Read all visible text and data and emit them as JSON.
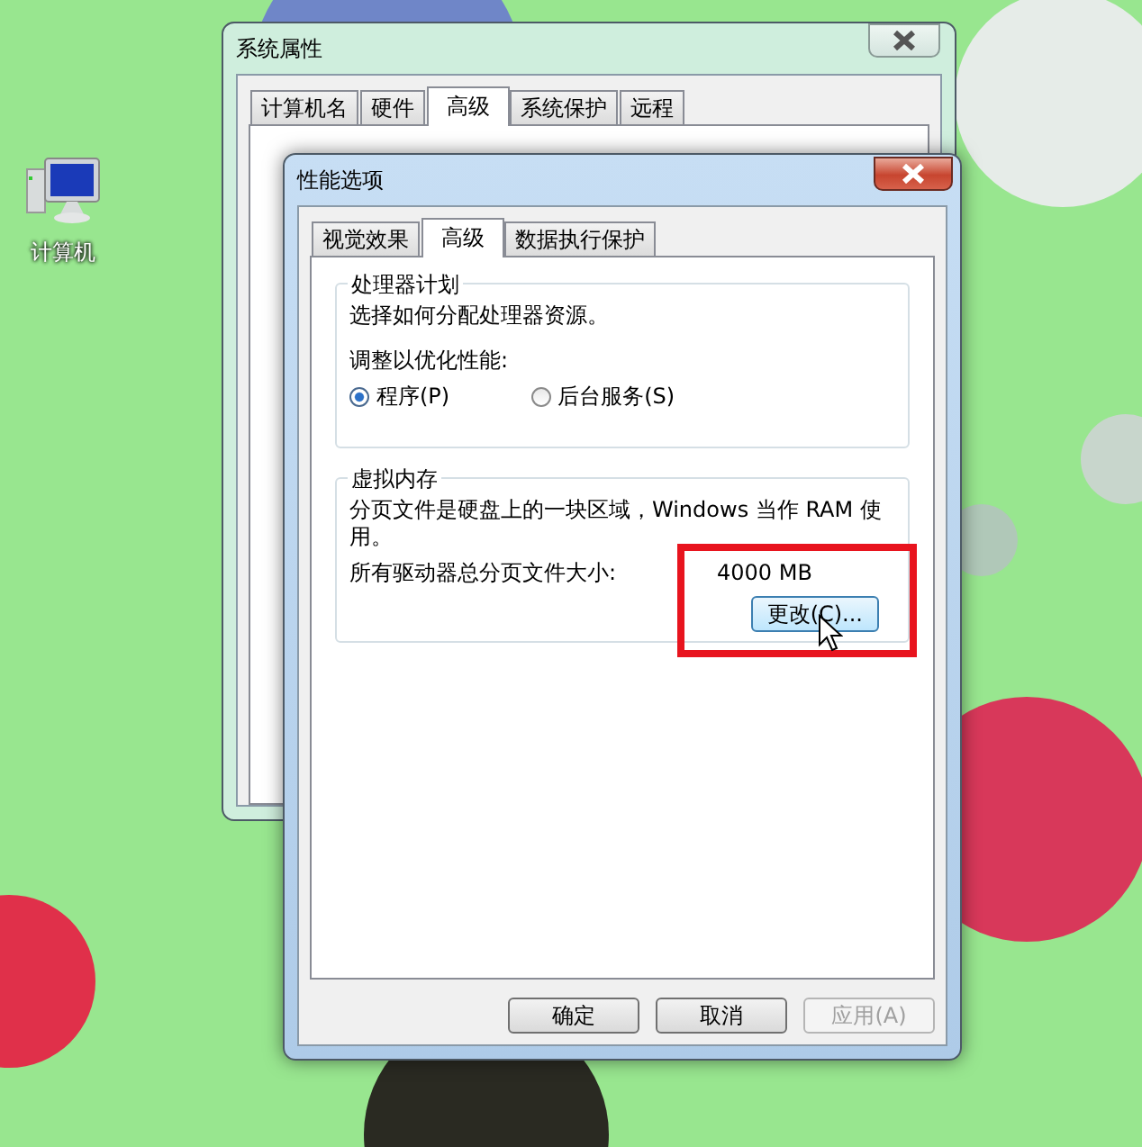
{
  "desktop": {
    "icons": [
      {
        "label": "计算机"
      }
    ]
  },
  "back_window": {
    "title": "系统属性",
    "tabs": [
      {
        "label": "计算机名",
        "selected": false
      },
      {
        "label": "硬件",
        "selected": false
      },
      {
        "label": "高级",
        "selected": true
      },
      {
        "label": "系统保护",
        "selected": false
      },
      {
        "label": "远程",
        "selected": false
      }
    ]
  },
  "front_window": {
    "title": "性能选项",
    "tabs": [
      {
        "label": "视觉效果",
        "selected": false
      },
      {
        "label": "高级",
        "selected": true
      },
      {
        "label": "数据执行保护",
        "selected": false
      }
    ],
    "processor_group": {
      "title": "处理器计划",
      "description": "选择如何分配处理器资源。",
      "adjust_label": "调整以优化性能:",
      "options": [
        {
          "label": "程序(P)",
          "selected": true
        },
        {
          "label": "后台服务(S)",
          "selected": false
        }
      ]
    },
    "memory_group": {
      "title": "虚拟内存",
      "description": "分页文件是硬盘上的一块区域，Windows 当作 RAM 使用。",
      "total_label": "所有驱动器总分页文件大小:",
      "total_value": "4000 MB",
      "change_button": "更改(C)..."
    },
    "buttons": [
      {
        "label": "确定",
        "disabled": false
      },
      {
        "label": "取消",
        "disabled": false
      },
      {
        "label": "应用(A)",
        "disabled": true
      }
    ]
  }
}
